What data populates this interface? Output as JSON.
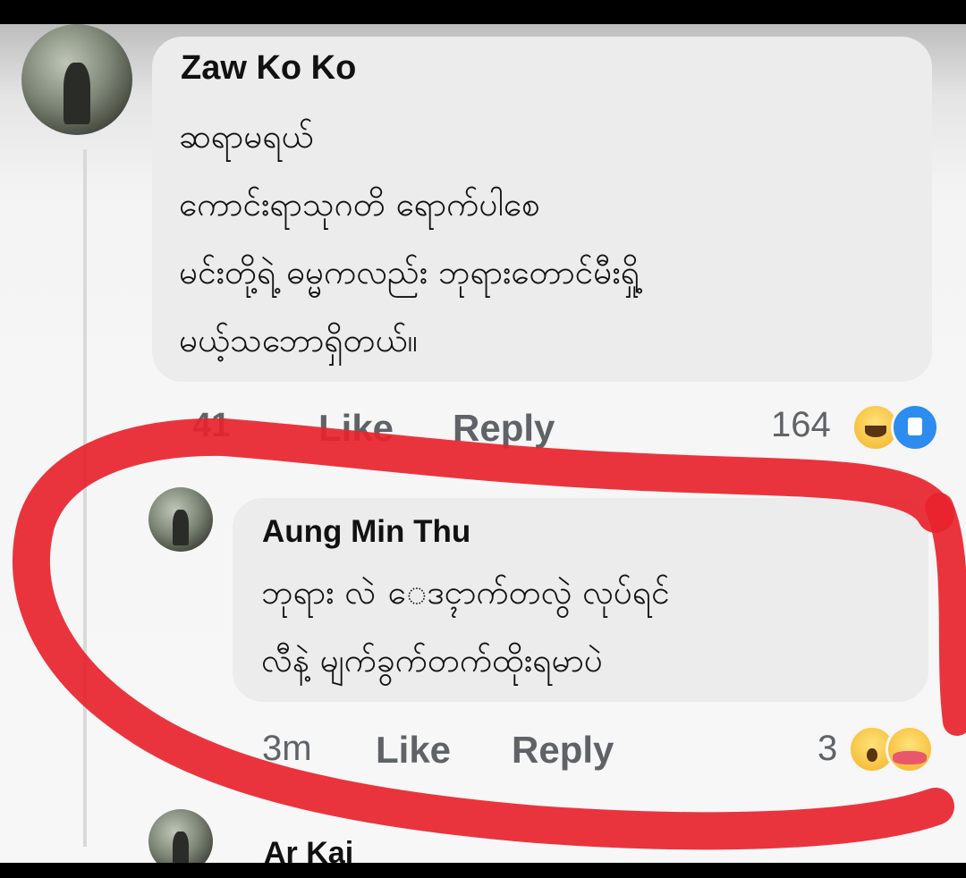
{
  "comments": [
    {
      "author": "Zaw Ko Ko",
      "text": "ဆရာမရယ်\nကောင်းရာသုဂတိ ရောက်ပါစေ\nမင်းတို့ရဲ့ ဓမ္မကလည်း ဘုရားတောင်မီးရှို့\nမယ့်သဘောရှိတယ်။",
      "time": "41",
      "like_label": "Like",
      "reply_label": "Reply",
      "reaction_count": "164",
      "reactions": [
        "haha-icon",
        "like-icon"
      ]
    },
    {
      "author": "Aung Min Thu",
      "text": "ဘုရား လဲ ေဒၚာက်တလွဲ လုပ်ရင်\nလီနဲ့ မျက်ခွက်တက်ထိုးရမာပဲ",
      "time": "3m",
      "like_label": "Like",
      "reply_label": "Reply",
      "reaction_count": "3",
      "reactions": [
        "wow-icon",
        "care-icon"
      ]
    },
    {
      "author": "Ar Kai"
    }
  ],
  "annotation_color": "#e8232c"
}
